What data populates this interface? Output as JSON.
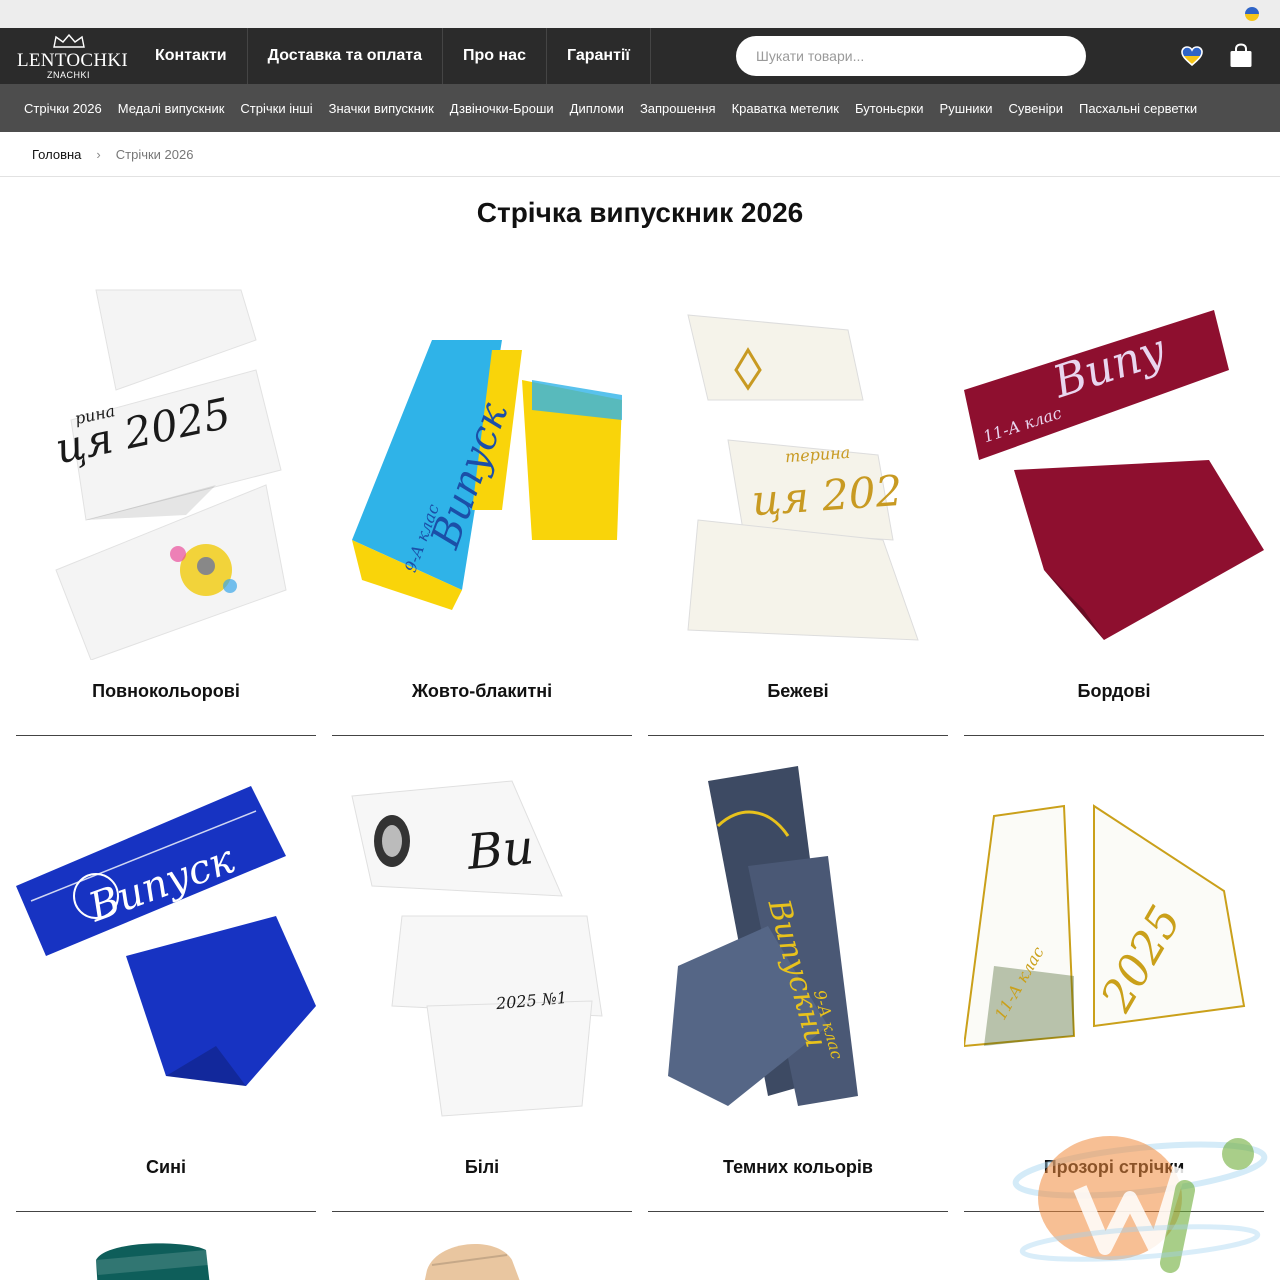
{
  "header": {
    "logo_text": "LENTOCHKI",
    "logo_sub": "ZNACHKI",
    "nav": [
      "Контакти",
      "Доставка та оплата",
      "Про нас",
      "Гарантії"
    ],
    "search_placeholder": "Шукати товари..."
  },
  "categories": [
    "Стрічки 2026",
    "Медалі випускник",
    "Стрічки інші",
    "Значки випускник",
    "Дзвіночки-Броши",
    "Дипломи",
    "Запрошення",
    "Краватка метелик",
    "Бутоньєрки",
    "Рушники",
    "Сувеніри",
    "Пасхальні серветки"
  ],
  "breadcrumb": {
    "home": "Головна",
    "separator": "›",
    "current": "Стрічки 2026"
  },
  "page_title": "Стрічка випускник 2026",
  "products": [
    {
      "title": "Повнокольорові",
      "ribbon_color": "#f4f4f4",
      "text_color": "#1a1a1a",
      "ribbon_text": "ця 2025",
      "small_text": "рина"
    },
    {
      "title": "Жовто-блакитні",
      "ribbon_color": "#2fb3e8",
      "ribbon_color_2": "#f9d40a",
      "text_color": "#1b4fa8",
      "ribbon_text": "Випуск",
      "small_text": "9-А клас"
    },
    {
      "title": "Бежеві",
      "ribbon_color": "#f5f3ea",
      "text_color": "#c89a22",
      "ribbon_text": "ця 202",
      "small_text": "терина"
    },
    {
      "title": "Бордові",
      "ribbon_color": "#8e0f2f",
      "text_color": "#e9d6ef",
      "ribbon_text": "Випу",
      "small_text": "11-А клас"
    },
    {
      "title": "Сині",
      "ribbon_color": "#1733c2",
      "text_color": "#ffffff",
      "ribbon_text": "Випуск",
      "small_text": ""
    },
    {
      "title": "Білі",
      "ribbon_color": "#f7f7f7",
      "text_color": "#1a1a1a",
      "ribbon_text": "Ви",
      "small_text": "2025 №1"
    },
    {
      "title": "Темних кольорів",
      "ribbon_color": "#3d4a63",
      "text_color": "#e8c21c",
      "ribbon_text": "Випускни",
      "small_text": "9-А клас"
    },
    {
      "title": "Прозорі стрічки",
      "ribbon_color": "#fbfbf7",
      "text_color": "#caa01a",
      "ribbon_text": "2025",
      "small_text": "11-А клас"
    }
  ],
  "partial_products": [
    {
      "ribbon_color": "#0e5e5a"
    },
    {
      "ribbon_color": "#e9c6a0"
    }
  ],
  "colors": {
    "topbar": "#ededed",
    "header": "#2b2b2b",
    "category_bar": "#4d4d4d"
  }
}
